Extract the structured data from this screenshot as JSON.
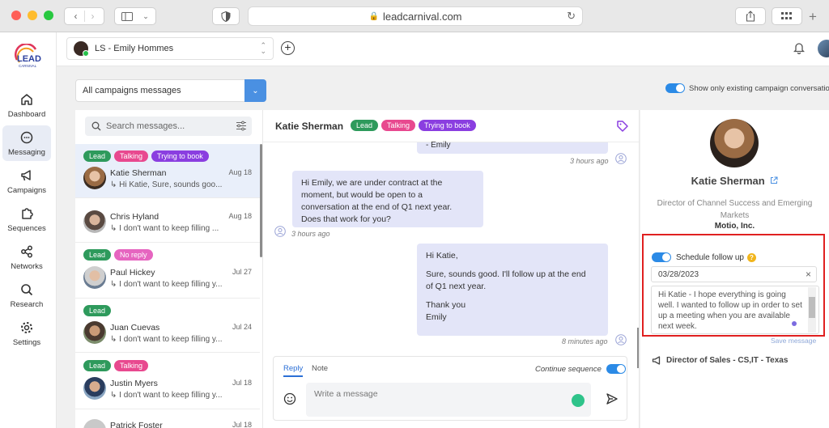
{
  "browser": {
    "url": "leadcarnival.com"
  },
  "brand": {
    "logo_top": "LEAD",
    "logo_bottom": "CARNIVAL",
    "accent": "#2b8ae6"
  },
  "nav": [
    {
      "label": "Dashboard",
      "icon": "home-icon"
    },
    {
      "label": "Messaging",
      "icon": "chat-icon"
    },
    {
      "label": "Campaigns",
      "icon": "megaphone-icon"
    },
    {
      "label": "Sequences",
      "icon": "puzzle-icon"
    },
    {
      "label": "Networks",
      "icon": "share-icon"
    },
    {
      "label": "Research",
      "icon": "search-icon"
    },
    {
      "label": "Settings",
      "icon": "gear-icon"
    }
  ],
  "topbar": {
    "account": "LS - Emily Hommes"
  },
  "filters": {
    "campaign_select": "All campaigns messages",
    "only_existing_label": "Show only existing campaign conversations"
  },
  "list": {
    "search_placeholder": "Search messages...",
    "conversations": [
      {
        "name": "Katie Sherman",
        "date": "Aug 18",
        "snippet": "↳ Hi Katie, Sure, sounds goo...",
        "tags": [
          "Lead",
          "Talking",
          "Trying to book"
        ]
      },
      {
        "name": "Chris Hyland",
        "date": "Aug 18",
        "snippet": "↳ I don't want to keep filling ...",
        "tags": []
      },
      {
        "name": "Paul Hickey",
        "date": "Jul 27",
        "snippet": "↳ I don't want to keep filling y...",
        "tags": [
          "Lead",
          "No reply"
        ]
      },
      {
        "name": "Juan Cuevas",
        "date": "Jul 24",
        "snippet": "↳ I don't want to keep filling y...",
        "tags": [
          "Lead"
        ]
      },
      {
        "name": "Justin Myers",
        "date": "Jul 18",
        "snippet": "↳ I don't want to keep filling y...",
        "tags": [
          "Lead",
          "Talking"
        ]
      },
      {
        "name": "Patrick Foster",
        "date": "Jul 18",
        "snippet": "",
        "tags": []
      }
    ]
  },
  "chat": {
    "name": "Katie Sherman",
    "tags": [
      "Lead",
      "Talking",
      "Trying to book"
    ],
    "msg0_tail": "- Emily",
    "msg0_time": "3 hours ago",
    "msg1_lines": [
      "Hi Emily, we are under contract at the",
      "moment, but would be open to a",
      "conversation at the end of Q1 next year.",
      "Does that work for you?"
    ],
    "msg1_time": "3 hours ago",
    "msg2_lines": [
      "Hi Katie,",
      "",
      "Sure, sounds good. I'll follow up at the end",
      "of Q1 next year.",
      "",
      "Thank you",
      "Emily"
    ],
    "msg2_time": "8 minutes ago",
    "composer": {
      "tab_reply": "Reply",
      "tab_note": "Note",
      "continue_sequence": "Continue sequence",
      "placeholder": "Write a message"
    }
  },
  "profile": {
    "name": "Katie Sherman",
    "title": "Director of Channel Success and Emerging Markets",
    "company": "Motio, Inc.",
    "followup_label": "Schedule follow up",
    "followup_date": "03/28/2023",
    "followup_text": "Hi Katie - I hope everything is going well. I wanted to follow up in order to set up a meeting when you are available next week.",
    "save_message": "Save message",
    "list_name": "Director of Sales - CS,IT - Texas"
  }
}
